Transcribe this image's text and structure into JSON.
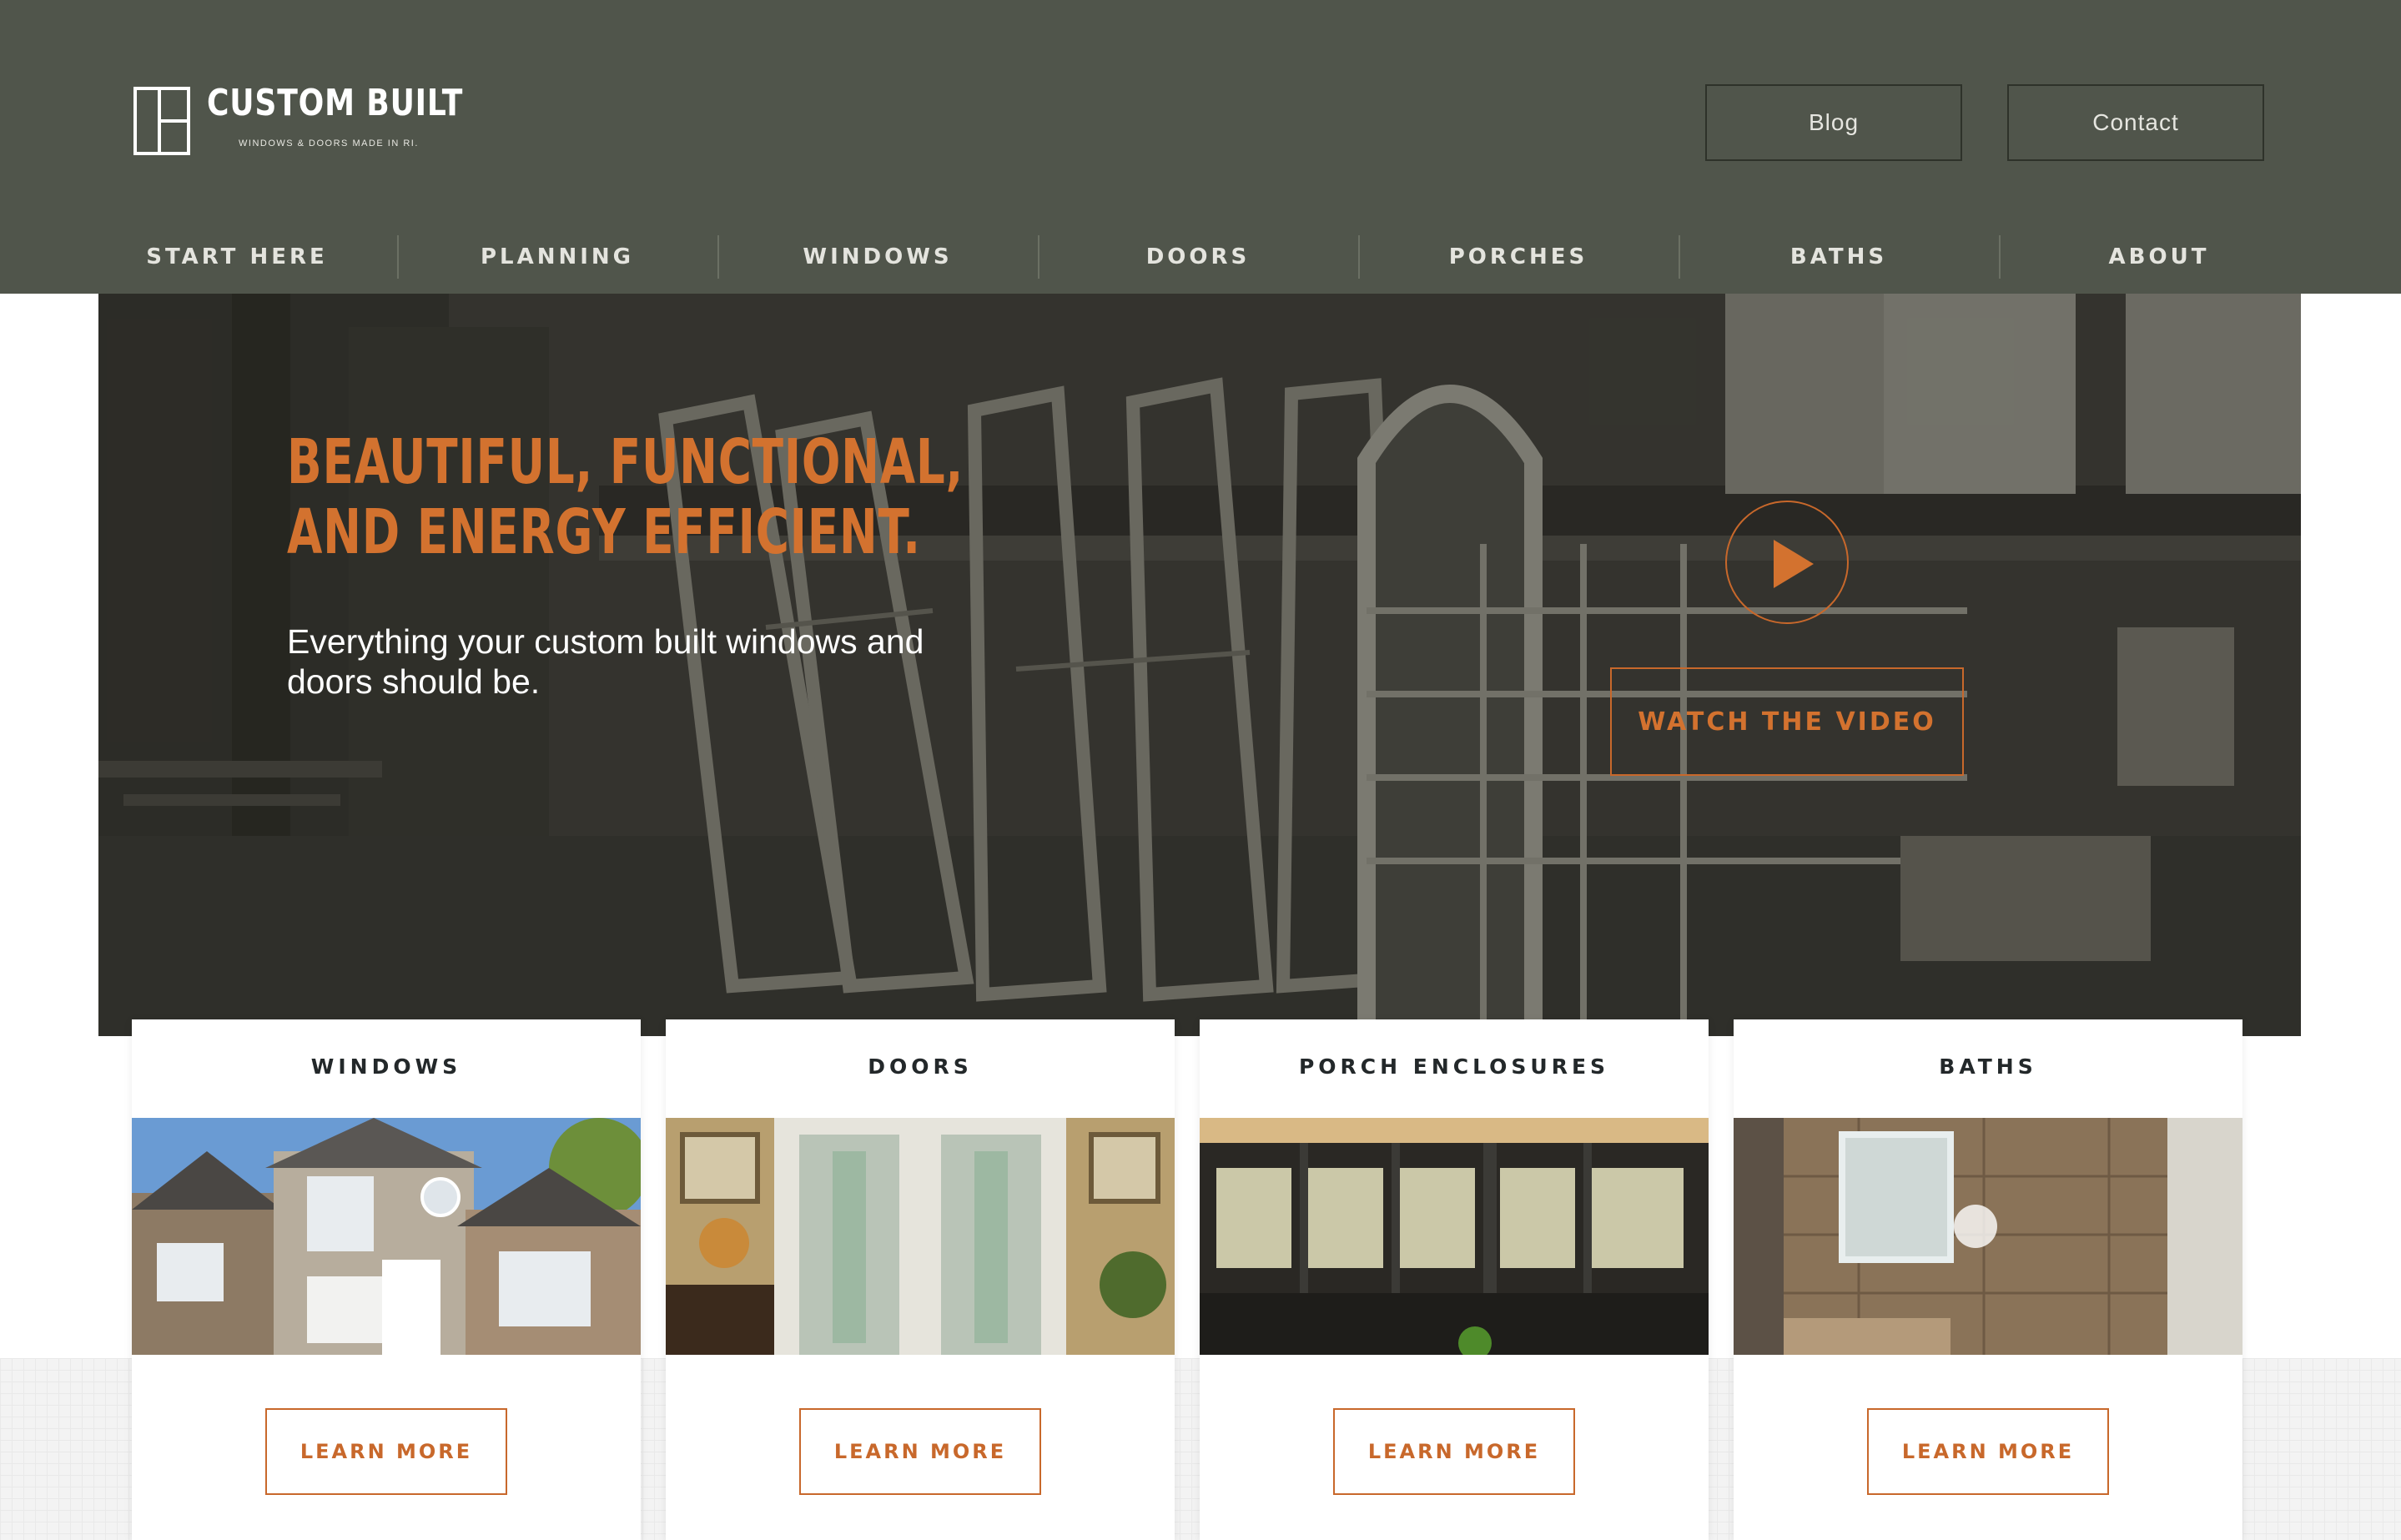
{
  "brand": {
    "name": "CUSTOM BUILT",
    "tagline": "WINDOWS & DOORS MADE IN RI.",
    "logo_icon": "window-frame-icon"
  },
  "top_links": [
    "Blog",
    "Contact"
  ],
  "nav": [
    "START HERE",
    "PLANNING",
    "WINDOWS",
    "DOORS",
    "PORCHES",
    "BATHS",
    "ABOUT"
  ],
  "hero": {
    "title_line1": "BEAUTIFUL, FUNCTIONAL,",
    "title_line2": "AND ENERGY EFFICIENT.",
    "subtitle": "Everything your custom built windows and doors should be.",
    "play_icon": "play-icon",
    "video_button": "WATCH THE VIDEO"
  },
  "cards": [
    {
      "title": "WINDOWS",
      "button": "LEARN MORE",
      "image": "house-exterior-photo"
    },
    {
      "title": "DOORS",
      "button": "LEARN MORE",
      "image": "glass-doors-photo"
    },
    {
      "title": "PORCH ENCLOSURES",
      "button": "LEARN MORE",
      "image": "porch-enclosure-photo"
    },
    {
      "title": "BATHS",
      "button": "LEARN MORE",
      "image": "shower-photo"
    }
  ],
  "colors": {
    "header_bg": "#50554b",
    "accent_orange": "#d3722f",
    "nav_text": "#e4e4de",
    "card_title": "#23282a"
  }
}
